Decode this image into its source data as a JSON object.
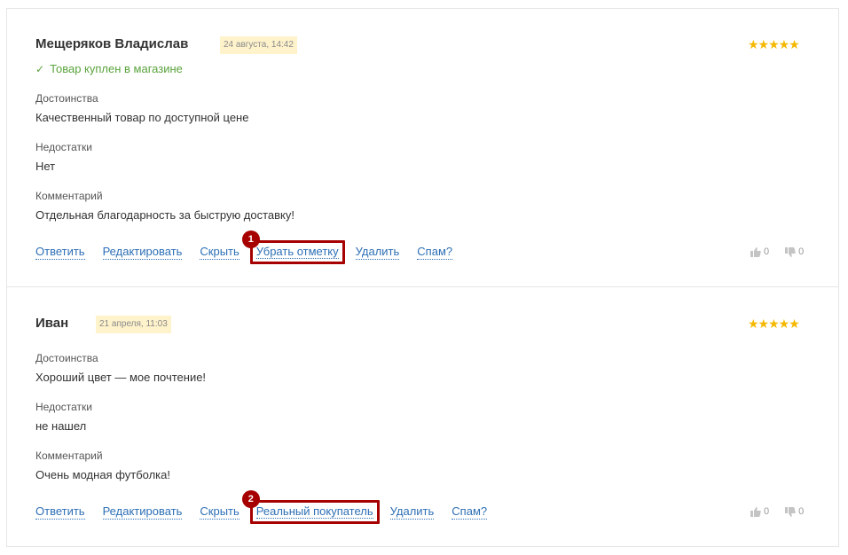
{
  "reviews": [
    {
      "author": "Мещеряков Владислав",
      "date": "24 августа, 14:42",
      "rating": "★★★★★",
      "purchased": "Товар куплен в магазине",
      "pros_label": "Достоинства",
      "pros": "Качественный товар по доступной цене",
      "cons_label": "Недостатки",
      "cons": "Нет",
      "comment_label": "Комментарий",
      "comment": "Отдельная благодарность за быструю доставку!",
      "actions": {
        "reply": "Ответить",
        "edit": "Редактировать",
        "hide": "Скрыть",
        "toggle_mark": "Убрать отметку",
        "delete": "Удалить",
        "spam": "Спам?"
      },
      "marker": "1",
      "likes": "0",
      "dislikes": "0"
    },
    {
      "author": "Иван",
      "date": "21 апреля, 11:03",
      "rating": "★★★★★",
      "pros_label": "Достоинства",
      "pros": "Хороший цвет — мое почтение!",
      "cons_label": "Недостатки",
      "cons": "не нашел",
      "comment_label": "Комментарий",
      "comment": "Очень модная футболка!",
      "actions": {
        "reply": "Ответить",
        "edit": "Редактировать",
        "hide": "Скрыть",
        "toggle_mark": "Реальный покупатель",
        "delete": "Удалить",
        "spam": "Спам?"
      },
      "marker": "2",
      "likes": "0",
      "dislikes": "0"
    }
  ],
  "colors": {
    "link": "#2d6fb5",
    "highlight": "#a60000",
    "star": "#f5b800",
    "purchased": "#5aa33c",
    "date_badge_bg": "#fff3cc"
  },
  "icons": [
    "check-icon",
    "thumbs-up-icon",
    "thumbs-down-icon",
    "star-icon"
  ]
}
